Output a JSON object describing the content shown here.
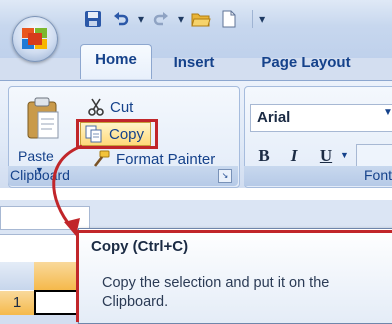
{
  "quick_access": {
    "icons": [
      "save-icon",
      "undo-icon",
      "redo-icon",
      "open-folder-icon",
      "new-document-icon",
      "customize-arrow-icon"
    ]
  },
  "tabs": [
    {
      "label": "Home",
      "active": true
    },
    {
      "label": "Insert",
      "active": false
    },
    {
      "label": "Page Layout",
      "active": false
    }
  ],
  "clipboard_group": {
    "label": "Clipboard",
    "paste_label": "Paste",
    "cut_label": "Cut",
    "copy_label": "Copy",
    "format_painter_label": "Format Painter"
  },
  "font_group": {
    "label": "Font",
    "font_name": "Arial",
    "bold_label": "B",
    "italic_label": "I",
    "underline_label": "U"
  },
  "sheet": {
    "row_label": "1"
  },
  "tooltip": {
    "title": "Copy (Ctrl+C)",
    "body": "Copy the selection and put it on the Clipboard."
  },
  "colors": {
    "highlight_red": "#c1262a",
    "ribbon_text": "#15428b",
    "copy_hover": "#ffd97a"
  }
}
